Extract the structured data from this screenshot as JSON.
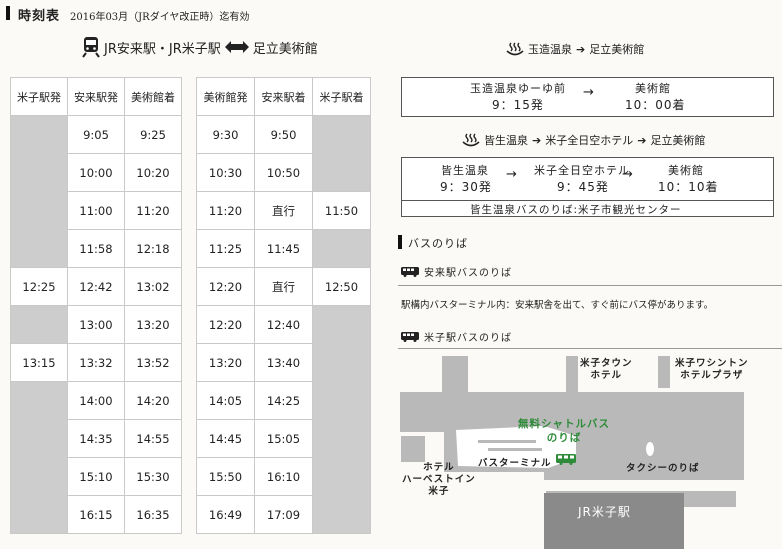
{
  "header": {
    "title": "時刻表",
    "date_note": "2016年03月（JRダイヤ改正時）迄有効"
  },
  "route_left": {
    "from": "JR安来駅・JR米子駅",
    "to": "足立美術館",
    "icon": "train-icon",
    "arrow": "double-arrow-icon"
  },
  "timetable_left": {
    "headers": [
      "米子駅発",
      "安来駅発",
      "美術館着"
    ],
    "rows": [
      [
        "",
        "9:05",
        "9:25"
      ],
      [
        "",
        "10:00",
        "10:20"
      ],
      [
        "",
        "11:00",
        "11:20"
      ],
      [
        "",
        "11:58",
        "12:18"
      ],
      [
        "12:25",
        "12:42",
        "13:02"
      ],
      [
        "",
        "13:00",
        "13:20"
      ],
      [
        "13:15",
        "13:32",
        "13:52"
      ],
      [
        "",
        "14:00",
        "14:20"
      ],
      [
        "",
        "14:35",
        "14:55"
      ],
      [
        "",
        "15:10",
        "15:30"
      ],
      [
        "",
        "16:15",
        "16:35"
      ]
    ]
  },
  "timetable_right": {
    "headers": [
      "美術館発",
      "安来駅着",
      "米子駅着"
    ],
    "rows": [
      [
        "9:30",
        "9:50",
        ""
      ],
      [
        "10:30",
        "10:50",
        ""
      ],
      [
        "11:20",
        "直行",
        "11:50"
      ],
      [
        "11:25",
        "11:45",
        ""
      ],
      [
        "12:20",
        "直行",
        "12:50"
      ],
      [
        "12:20",
        "12:40",
        ""
      ],
      [
        "13:20",
        "13:40",
        ""
      ],
      [
        "14:05",
        "14:25",
        ""
      ],
      [
        "14:45",
        "15:05",
        ""
      ],
      [
        "15:50",
        "16:10",
        ""
      ],
      [
        "16:49",
        "17:09",
        ""
      ]
    ]
  },
  "tamatsukuri": {
    "heading_from": "玉造温泉",
    "heading_to": "足立美術館",
    "stop1": "玉造温泉ゆーゆ前",
    "stop2": "美術館",
    "time1": "9：15発",
    "time2": "10：00着"
  },
  "kaike": {
    "heading_a": "皆生温泉",
    "heading_b": "米子全日空ホテル",
    "heading_c": "足立美術館",
    "stop1": "皆生温泉",
    "stop2": "米子全日空ホテル",
    "stop3": "美術館",
    "time1": "9：30発",
    "time2": "9：45発",
    "time3": "10：10着",
    "pickup": "皆生温泉バスのりば:米子市観光センター"
  },
  "bus_section": {
    "title": "バスのりば",
    "yasugi_title": "安来駅バスのりば",
    "yasugi_desc": "駅構内バスターミナル内：安来駅舎を出て、すぐ前にバス停があります。",
    "yonago_title": "米子駅バスのりば"
  },
  "map": {
    "town_hotel": [
      "米子タウン",
      "ホテル"
    ],
    "washington": [
      "米子ワシントン",
      "ホテルプラザ"
    ],
    "shuttle": [
      "無料シャトルバス",
      "のりば"
    ],
    "terminal": "バスターミナル",
    "taxi": "タクシーのりば",
    "harvest": [
      "ホテル",
      "ハーベストイン",
      "米子"
    ],
    "station": "JR米子駅"
  },
  "colors": {
    "blank_cell": "#cdcdcd",
    "map_gray": "#b9b9b9",
    "station_dark": "#8a8a8a",
    "shuttle_green": "#2e8b3a"
  }
}
